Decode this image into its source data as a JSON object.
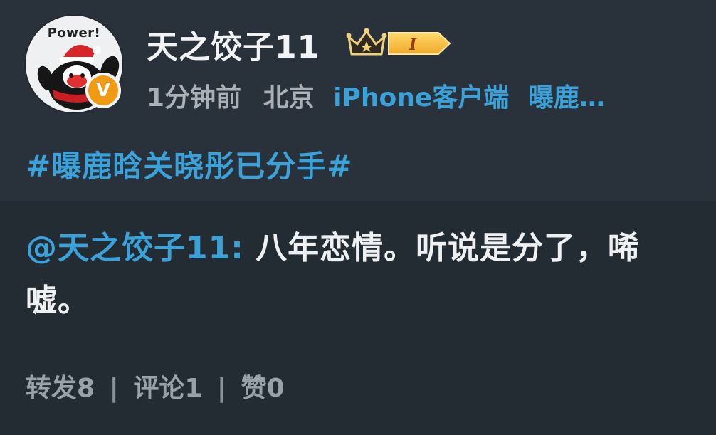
{
  "post": {
    "author": {
      "name": "天之饺子11",
      "avatar_text": "Power!",
      "verified_badge": "V",
      "level": "I"
    },
    "meta": {
      "time": "1分钟前",
      "location": "北京",
      "client": "iPhone客户端",
      "extra": "曝鹿…"
    },
    "hashtag": "#曝鹿晗关晓彤已分手#",
    "repost": {
      "mention": "@天之饺子11:",
      "text": " 八年恋情。听说是分了，唏嘘。"
    },
    "stats": {
      "repost": "转发8",
      "comment": "评论1",
      "like": "赞0",
      "separator": "|"
    }
  },
  "colors": {
    "background_top": "#29313a",
    "background_bottom": "#232b33",
    "link_blue": "#3aa1d9",
    "muted_gray": "#a9b0b7",
    "badge_orange": "#f29a14"
  }
}
